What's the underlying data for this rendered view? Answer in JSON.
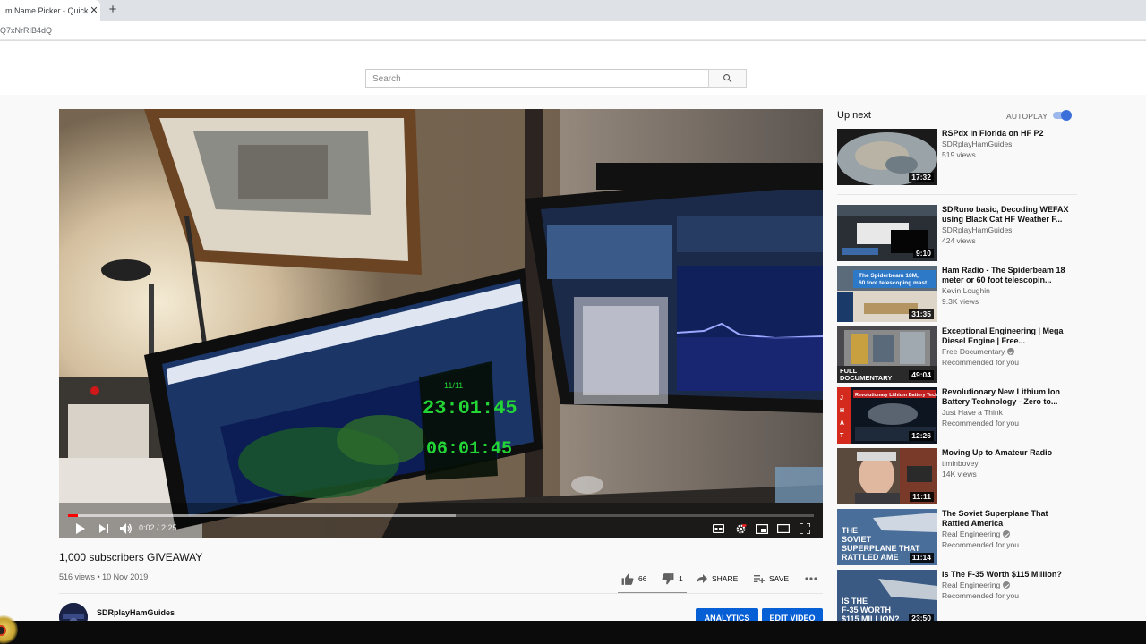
{
  "browser": {
    "tab_title": "m Name Picker - Quickly P",
    "close_glyph": "✕",
    "new_tab_glyph": "+",
    "url": "Q7xNrRIB4dQ"
  },
  "header": {
    "search_placeholder": "Search",
    "search_value": ""
  },
  "player": {
    "time": "0:02 / 2:25",
    "progress_fraction": 0.013,
    "buffered_fraction": 0.52,
    "overlay_text": [
      "11/11",
      "23:01:45",
      "06:01:45"
    ]
  },
  "video": {
    "title": "1,000 subscribers GIVEAWAY",
    "meta": "516 views • 10 Nov 2019",
    "likes": "66",
    "dislikes": "1",
    "share_label": "SHARE",
    "save_label": "SAVE",
    "channel": "SDRplayHamGuides",
    "analytics_label": "ANALYTICS",
    "edit_label": "EDIT VIDEO"
  },
  "sidebar": {
    "up_next": "Up next",
    "autoplay_label": "AUTOPLAY",
    "autoplay_on": true,
    "items": [
      {
        "title": "RSPdx in Florida on HF P2",
        "channel": "SDRplayHamGuides",
        "views": "519 views",
        "duration": "17:32",
        "verified": false,
        "thumb_text": ""
      },
      {
        "title": "SDRuno basic, Decoding WEFAX using Black Cat HF Weather F...",
        "channel": "SDRplayHamGuides",
        "views": "424 views",
        "duration": "9:10",
        "verified": false,
        "thumb_text": ""
      },
      {
        "title": "Ham Radio - The Spiderbeam 18 meter or 60 foot telescopin...",
        "channel": "Kevin Loughin",
        "views": "9.3K views",
        "duration": "31:35",
        "verified": false,
        "thumb_text": "The Spiderbeam 18M, 60 foot telescoping mast."
      },
      {
        "title": "Exceptional Engineering | Mega Diesel Engine | Free...",
        "channel": "Free Documentary",
        "views": "Recommended for you",
        "duration": "49:04",
        "verified": true,
        "thumb_text": "FULL DOCUMENTARY"
      },
      {
        "title": "Revolutionary New Lithium Ion Battery Technology - Zero to...",
        "channel": "Just Have a Think",
        "views": "Recommended for you",
        "duration": "12:26",
        "verified": false,
        "thumb_text": "Revolutionary Lithium Battery Tech"
      },
      {
        "title": "Moving Up to Amateur Radio",
        "channel": "timinbovey",
        "views": "14K views",
        "duration": "11:11",
        "verified": false,
        "thumb_text": ""
      },
      {
        "title": "The Soviet Superplane That Rattled America",
        "channel": "Real Engineering",
        "views": "Recommended for you",
        "duration": "11:14",
        "verified": true,
        "thumb_text": "THE SOVIET SUPERPLANE THAT RATTLED AME"
      },
      {
        "title": "Is The F-35 Worth $115 Million?",
        "channel": "Real Engineering",
        "views": "Recommended for you",
        "duration": "23:50",
        "verified": true,
        "thumb_text": "IS THE F-35 WORTH $115 MILLION?"
      }
    ]
  },
  "colors": {
    "accent": "#065fd4",
    "progress": "#ff0000",
    "toggle": "#3b6fd9"
  },
  "icons": [
    "search-icon",
    "play-icon",
    "next-icon",
    "volume-icon",
    "captions-icon",
    "settings-icon",
    "miniplayer-icon",
    "theater-icon",
    "fullscreen-icon",
    "like-icon",
    "dislike-icon",
    "share-icon",
    "save-icon",
    "more-icon"
  ]
}
